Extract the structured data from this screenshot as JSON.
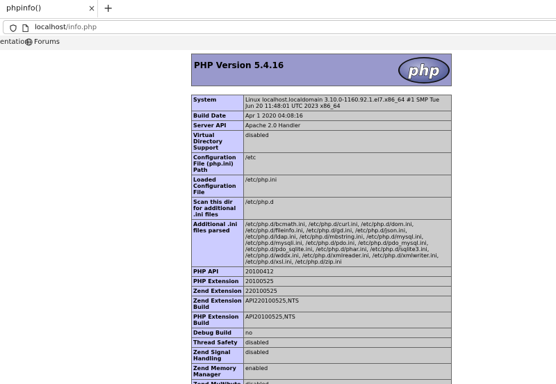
{
  "browser": {
    "tab_title": "phpinfo()",
    "tab_close": "×",
    "new_tab": "+",
    "url_host": "localhost",
    "url_path": "/info.php",
    "bookmarks": [
      "entation",
      "Forums"
    ]
  },
  "php": {
    "header_title": "PHP Version 5.4.16",
    "logo_text": "php",
    "rows": [
      {
        "key": "System",
        "value": "Linux localhost.localdomain 3.10.0-1160.92.1.el7.x86_64 #1 SMP Tue Jun 20 11:48:01 UTC 2023 x86_64"
      },
      {
        "key": "Build Date",
        "value": "Apr 1 2020 04:08:16"
      },
      {
        "key": "Server API",
        "value": "Apache 2.0 Handler"
      },
      {
        "key": "Virtual Directory Support",
        "value": "disabled"
      },
      {
        "key": "Configuration File (php.ini) Path",
        "value": "/etc"
      },
      {
        "key": "Loaded Configuration File",
        "value": "/etc/php.ini"
      },
      {
        "key": "Scan this dir for additional .ini files",
        "value": "/etc/php.d"
      },
      {
        "key": "Additional .ini files parsed",
        "value": "/etc/php.d/bcmath.ini, /etc/php.d/curl.ini, /etc/php.d/dom.ini, /etc/php.d/fileinfo.ini, /etc/php.d/gd.ini, /etc/php.d/json.ini, /etc/php.d/ldap.ini, /etc/php.d/mbstring.ini, /etc/php.d/mysql.ini, /etc/php.d/mysqli.ini, /etc/php.d/pdo.ini, /etc/php.d/pdo_mysql.ini, /etc/php.d/pdo_sqlite.ini, /etc/php.d/phar.ini, /etc/php.d/sqlite3.ini, /etc/php.d/wddx.ini, /etc/php.d/xmlreader.ini, /etc/php.d/xmlwriter.ini, /etc/php.d/xsl.ini, /etc/php.d/zip.ini"
      },
      {
        "key": "PHP API",
        "value": "20100412"
      },
      {
        "key": "PHP Extension",
        "value": "20100525"
      },
      {
        "key": "Zend Extension",
        "value": "220100525"
      },
      {
        "key": "Zend Extension Build",
        "value": "API220100525,NTS"
      },
      {
        "key": "PHP Extension Build",
        "value": "API20100525,NTS"
      },
      {
        "key": "Debug Build",
        "value": "no"
      },
      {
        "key": "Thread Safety",
        "value": "disabled"
      },
      {
        "key": "Zend Signal Handling",
        "value": "disabled"
      },
      {
        "key": "Zend Memory Manager",
        "value": "enabled"
      },
      {
        "key": "Zend Multibyte Support",
        "value": "disabled"
      }
    ]
  }
}
